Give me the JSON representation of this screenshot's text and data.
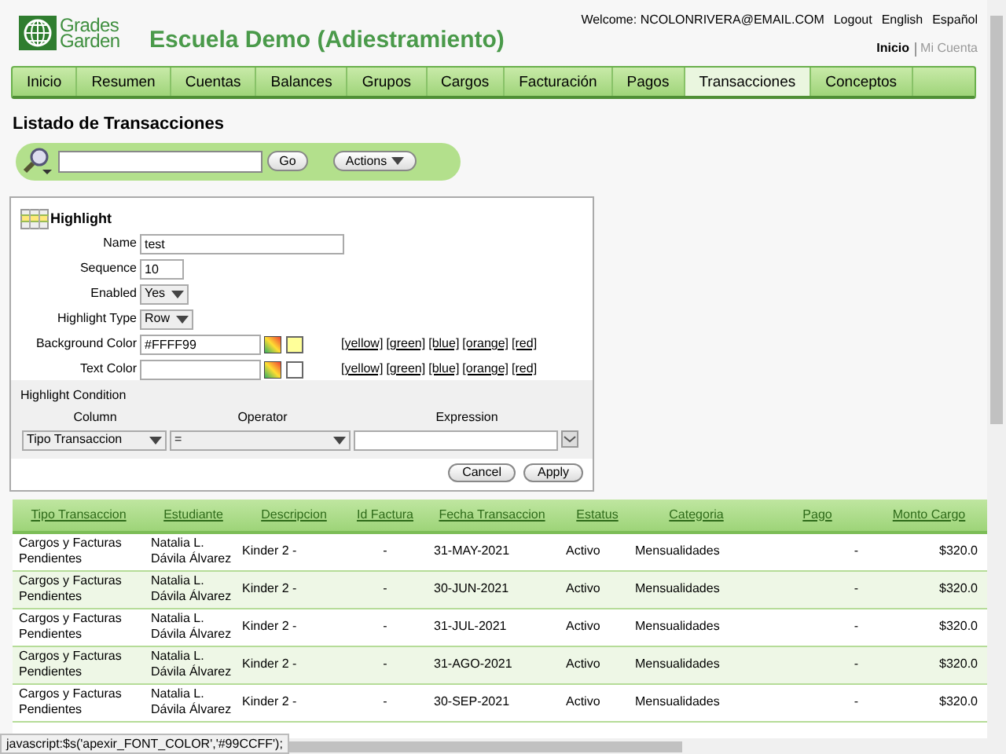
{
  "header": {
    "logo": [
      "Grades",
      "Garden"
    ],
    "title": "Escuela Demo (Adiestramiento)",
    "welcome": "Welcome: NCOLONRIVERA@EMAIL.COM",
    "top_links": [
      "Logout",
      "English",
      "Español"
    ],
    "account_links": [
      {
        "label": "Inicio",
        "selected": true
      },
      {
        "label": "Mi Cuenta",
        "selected": false
      }
    ]
  },
  "tabs": [
    {
      "label": "Inicio",
      "selected": false
    },
    {
      "label": "Resumen",
      "selected": false
    },
    {
      "label": "Cuentas",
      "selected": false
    },
    {
      "label": "Balances",
      "selected": false
    },
    {
      "label": "Grupos",
      "selected": false
    },
    {
      "label": "Cargos",
      "selected": false
    },
    {
      "label": "Facturación",
      "selected": false
    },
    {
      "label": "Pagos",
      "selected": false
    },
    {
      "label": "Transacciones",
      "selected": true
    },
    {
      "label": "Conceptos",
      "selected": false
    }
  ],
  "page_title": "Listado de Transacciones",
  "search": {
    "go": "Go",
    "actions": "Actions"
  },
  "highlight": {
    "title": "Highlight",
    "fields": [
      {
        "kind": "text",
        "label": "Name",
        "value": "test"
      },
      {
        "kind": "short",
        "label": "Sequence",
        "value": "10"
      },
      {
        "kind": "select",
        "label": "Enabled",
        "value": "Yes"
      },
      {
        "kind": "select",
        "label": "Highlight Type",
        "value": "Row"
      },
      {
        "kind": "color",
        "label": "Background Color",
        "value": "#FFFF99",
        "links": [
          "[yellow]",
          "[green]",
          "[blue]",
          "[orange]",
          "[red]"
        ]
      },
      {
        "kind": "color",
        "label": "Text Color",
        "links": [
          "[yellow]",
          "[green]",
          "[blue]",
          "[orange]",
          "[red]"
        ]
      }
    ],
    "condition": {
      "title": "Highlight Condition",
      "column_label": "Column",
      "operator_label": "Operator",
      "expression_label": "Expression",
      "column": "Tipo Transaccion",
      "operator": "="
    },
    "buttons": [
      "Cancel",
      "Apply"
    ]
  },
  "table": {
    "columns": [
      "Tipo Transaccion",
      "Estudiante",
      "Descripcion",
      "Id Factura",
      "Fecha Transaccion",
      "Estatus",
      "Categoria",
      "Pago",
      "Monto Cargo"
    ],
    "rows": [
      [
        "Cargos y Facturas Pendientes",
        "Natalia L. Dávila Álvarez",
        "Kinder 2 -",
        "-",
        "31-MAY-2021",
        "Activo",
        "Mensualidades",
        "-",
        "$320.0"
      ],
      [
        "Cargos y Facturas Pendientes",
        "Natalia L. Dávila Álvarez",
        "Kinder 2 -",
        "-",
        "30-JUN-2021",
        "Activo",
        "Mensualidades",
        "-",
        "$320.0"
      ],
      [
        "Cargos y Facturas Pendientes",
        "Natalia L. Dávila Álvarez",
        "Kinder 2 -",
        "-",
        "31-JUL-2021",
        "Activo",
        "Mensualidades",
        "-",
        "$320.0"
      ],
      [
        "Cargos y Facturas Pendientes",
        "Natalia L. Dávila Álvarez",
        "Kinder 2 -",
        "-",
        "31-AGO-2021",
        "Activo",
        "Mensualidades",
        "-",
        "$320.0"
      ],
      [
        "Cargos y Facturas Pendientes",
        "Natalia L. Dávila Álvarez",
        "Kinder 2 -",
        "-",
        "30-SEP-2021",
        "Activo",
        "Mensualidades",
        "-",
        "$320.0"
      ]
    ]
  },
  "status_bar": "javascript:$s('apexir_FONT_COLOR','#99CCFF');"
}
